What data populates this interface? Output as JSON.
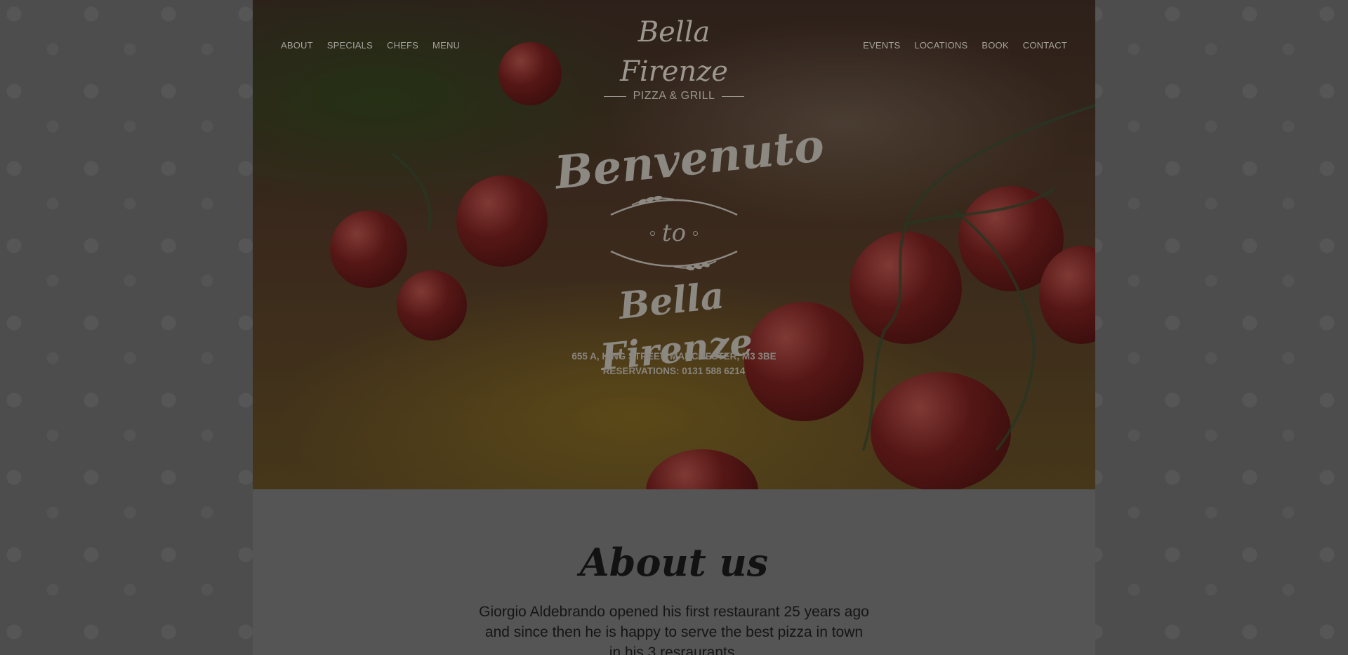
{
  "nav": {
    "left": [
      "ABOUT",
      "SPECIALS",
      "CHEFS",
      "MENU"
    ],
    "right": [
      "EVENTS",
      "LOCATIONS",
      "BOOK",
      "CONTACT"
    ]
  },
  "brand": {
    "name": "Bella Firenze",
    "tagline": "PIZZA & GRILL"
  },
  "hero": {
    "welcome_line1": "Benvenuto",
    "welcome_line2": "to",
    "welcome_line3": "Bella Firenze",
    "address": "655 A, KING STREET, MANCHESTER, M3 3BE",
    "reservations": "RESERVATIONS: 0131 588 6214"
  },
  "about": {
    "title": "About us",
    "text": "Giorgio Aldebrando opened his first restaurant 25 years ago and since then he is happy to serve the best pizza in town in his 3 resraurants."
  }
}
